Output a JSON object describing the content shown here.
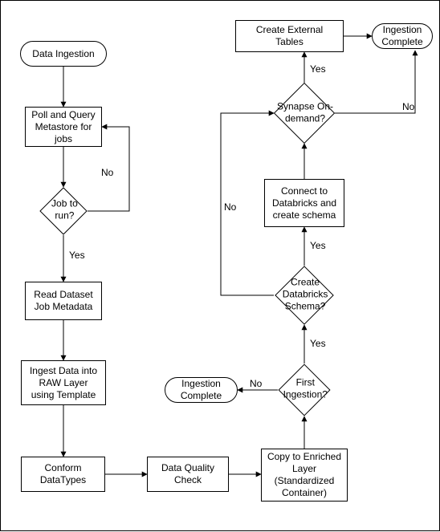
{
  "nodes": {
    "start": {
      "label": "Data Ingestion"
    },
    "poll": {
      "label": "Poll and Query Metastore for jobs"
    },
    "job_to_run": {
      "label": "Job to run?"
    },
    "read_metadata": {
      "label": "Read Dataset Job Metadata"
    },
    "ingest_raw": {
      "label": "Ingest Data into RAW Layer using Template"
    },
    "conform": {
      "label": "Conform DataTypes"
    },
    "dq_check": {
      "label": "Data Quality Check"
    },
    "copy_enriched": {
      "label": "Copy to Enriched Layer (Standardized Container)"
    },
    "first_ingestion": {
      "label": "First Ingestion?"
    },
    "ingest_complete2": {
      "label": "Ingestion Complete"
    },
    "create_schema_q": {
      "label": "Create Databricks Schema?"
    },
    "connect_db": {
      "label": "Connect to Databricks and create schema"
    },
    "synapse_q": {
      "label": "Synapse On-demand?"
    },
    "create_ext": {
      "label": "Create External Tables"
    },
    "ingest_complete1": {
      "label": "Ingestion Complete"
    }
  },
  "edge_labels": {
    "job_no": "No",
    "job_yes": "Yes",
    "first_no": "No",
    "first_yes": "Yes",
    "schema_no": "No",
    "schema_yes": "Yes",
    "syn_no": "No",
    "syn_yes": "Yes"
  }
}
